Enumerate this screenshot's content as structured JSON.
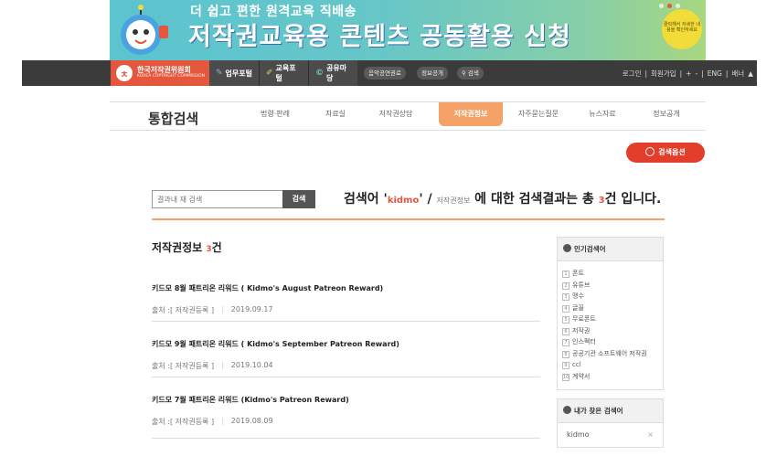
{
  "banner": {
    "top_text": "더 쉽고 편한 원격교육 직배송",
    "main_text": "저작권교육용 콘텐츠 공동활용 신청",
    "badge_text": "클릭해서 자세한 내용을 확인하세요"
  },
  "nav": {
    "logo_text": "한국저작권위원회",
    "logo_sub": "KOREA COPYRIGHT COMMISSION",
    "portals": [
      {
        "label": "업무포털"
      },
      {
        "label": "교육포털"
      },
      {
        "label": "공유마당"
      }
    ],
    "pills": [
      "음악공연권료",
      "정보공개",
      "검색"
    ],
    "right": {
      "login": "로그인",
      "signup": "회원가입",
      "plus": "+",
      "minus": "-",
      "eng": "ENG",
      "banner": "배너"
    }
  },
  "tabs": {
    "title": "통합검색",
    "items": [
      "법령·판례",
      "자료실",
      "저작권상담",
      "저작권정보",
      "자주묻는질문",
      "뉴스자료",
      "정보공개"
    ],
    "active_index": 3
  },
  "search_options_label": "검색옵션",
  "search": {
    "placeholder": "결과내 재 검색",
    "button": "검색"
  },
  "summary": {
    "prefix": "검색어 '",
    "keyword": "kidmo",
    "mid": "' / ",
    "category": "저작권정보",
    "suffix1": " 에 대한 검색결과는 총 ",
    "count": "3",
    "suffix2": "건 입니다."
  },
  "section": {
    "title": "저작권정보 ",
    "count": "3",
    "unit": "건"
  },
  "results": [
    {
      "title": "키드모 8월 패트리온 리워드 ( Kidmo's August Patreon Reward)",
      "source": "출처 :[ 저작권등록 ]",
      "date": "2019.09.17"
    },
    {
      "title": "키드모 9월 패트리온 리워드 ( Kidmo's September Patreon Reward)",
      "source": "출처 :[ 저작권등록 ]",
      "date": "2019.10.04"
    },
    {
      "title": "키드모 7월 패트리온 리워드 (Kidmo's Patreon Reward)",
      "source": "출처 :[ 저작권등록 ]",
      "date": "2019.08.09"
    }
  ],
  "popular": {
    "title": "인기검색어",
    "items": [
      "폰트",
      "유튜브",
      "맹수",
      "글꼴",
      "무료폰트",
      "저작권",
      "인스펙터",
      "공공기관 소프트웨어 저작권",
      "ccl",
      "계약서"
    ]
  },
  "my_searches": {
    "title": "내가 찾은 검색어",
    "items": [
      {
        "keyword": "kidmo",
        "remove": "×"
      }
    ]
  },
  "colors": {
    "accent": "#e4573d",
    "tab_active": "#f4a267",
    "nav_bg": "#3b3b3b"
  }
}
